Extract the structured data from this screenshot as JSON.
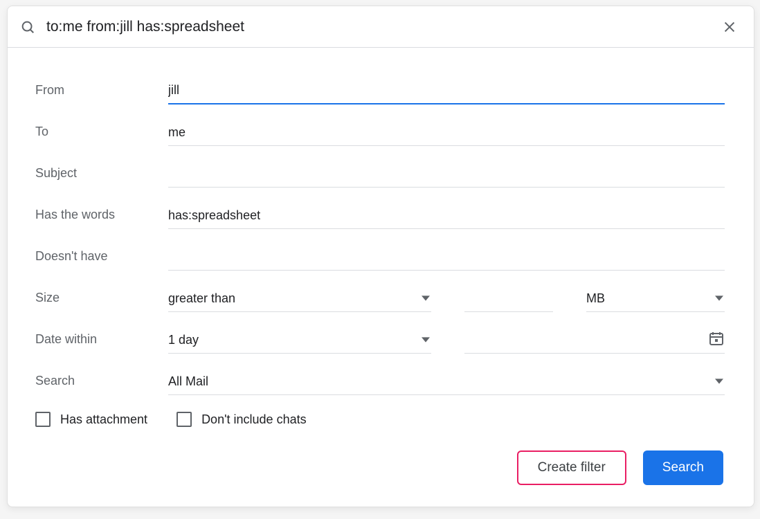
{
  "search": {
    "query": "to:me from:jill has:spreadsheet"
  },
  "fields": {
    "from_label": "From",
    "from_value": "jill",
    "to_label": "To",
    "to_value": "me",
    "subject_label": "Subject",
    "subject_value": "",
    "haswords_label": "Has the words",
    "haswords_value": "has:spreadsheet",
    "nothave_label": "Doesn't have",
    "nothave_value": "",
    "size_label": "Size",
    "size_op": "greater than",
    "size_value": "",
    "size_unit": "MB",
    "date_label": "Date within",
    "date_range": "1 day",
    "search_label": "Search",
    "search_scope": "All Mail"
  },
  "checks": {
    "has_attachment": "Has attachment",
    "exclude_chats": "Don't include chats"
  },
  "footer": {
    "create_filter": "Create filter",
    "search_btn": "Search"
  }
}
